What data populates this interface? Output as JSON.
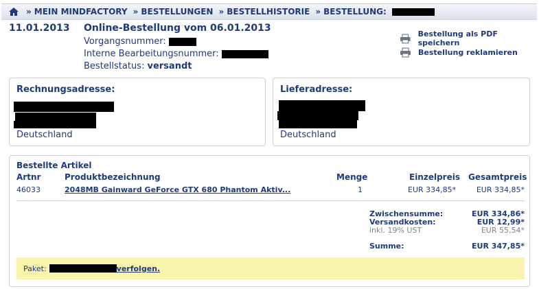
{
  "breadcrumb": {
    "items": [
      "MEIN MINDFACTORY",
      "BESTELLUNGEN",
      "BESTELLHISTORIE",
      "BESTELLUNG:"
    ],
    "separator": "»"
  },
  "order": {
    "date": "11.01.2013",
    "title": "Online-Bestellung vom 06.01.2013",
    "process_label": "Vorgangsnummer:",
    "internal_label": "Interne Bearbeitungsnummer:",
    "status_label": "Bestellstatus:",
    "status_value": "versandt"
  },
  "actions": {
    "save_pdf": "Bestellung als PDF speichern",
    "complain": "Bestellung reklamieren"
  },
  "billing": {
    "title": "Rechnungsadresse:",
    "country": "Deutschland"
  },
  "shipping": {
    "title": "Lieferadresse:",
    "country": "Deutschland"
  },
  "articles": {
    "title": "Bestellte Artikel",
    "headers": {
      "artnr": "Artnr",
      "description": "Produktbezeichnung",
      "quantity": "Menge",
      "unit_price": "Einzelpreis",
      "total_price": "Gesamtpreis"
    },
    "rows": [
      {
        "artnr": "46033",
        "description": "2048MB Gainward GeForce GTX 680 Phantom Aktiv...",
        "quantity": "1",
        "unit_price": "EUR 334,85*",
        "total_price": "EUR 334,85*"
      }
    ]
  },
  "totals": {
    "subtotal_label": "Zwischensumme:",
    "subtotal_value": "EUR 334,86*",
    "shipping_label": "Versandkosten:",
    "shipping_value": "EUR 12,99*",
    "tax_label": "inkl. 19% UST",
    "tax_value": "EUR 55,54*",
    "sum_label": "Summe:",
    "sum_value": "EUR 347,85*"
  },
  "tracking": {
    "label": "Paket:",
    "link": "verfolgen."
  },
  "colors": {
    "primary": "#1f3a7a",
    "highlight": "#f8f3ad",
    "border": "#c9ced8",
    "muted": "#7b8494"
  }
}
